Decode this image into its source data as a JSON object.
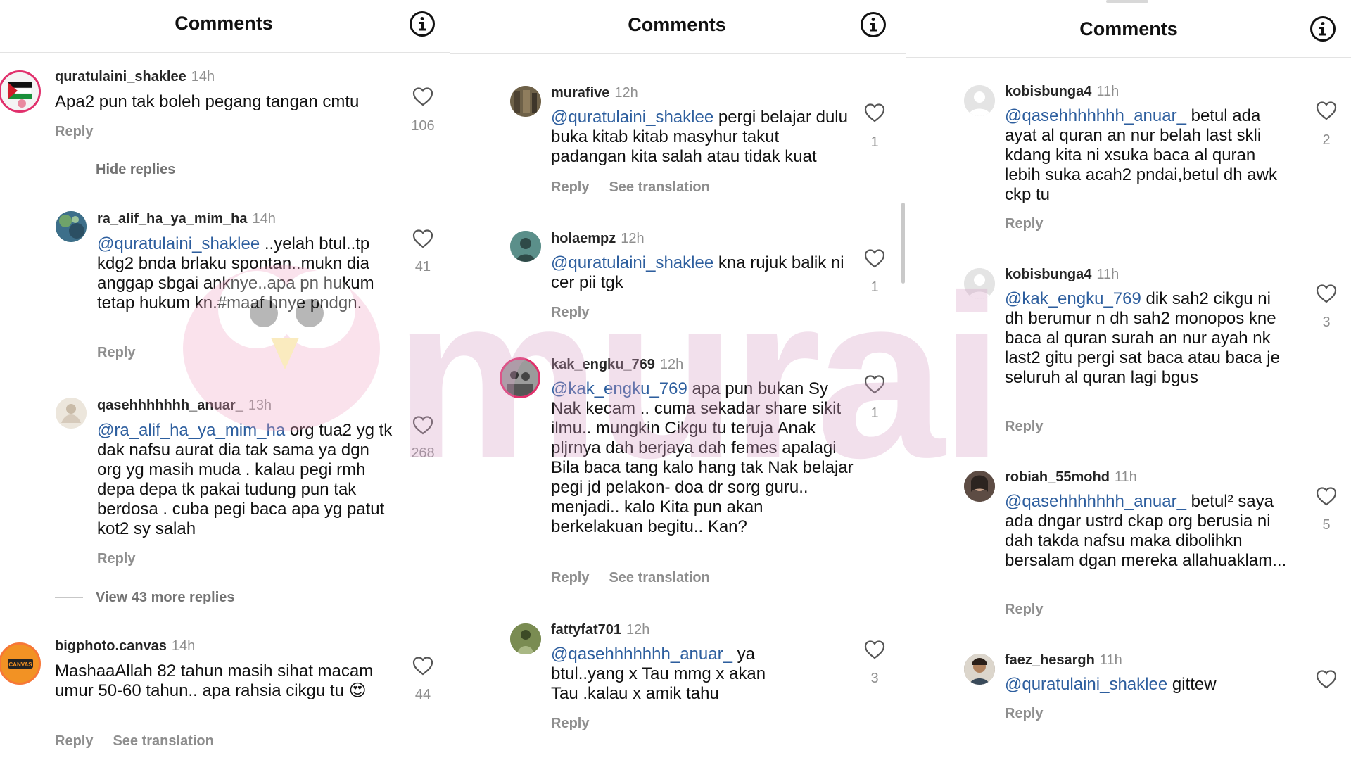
{
  "header": {
    "title": "Comments",
    "info_icon": "info-circle-icon"
  },
  "labels": {
    "reply": "Reply",
    "see_translation": "See translation",
    "hide_replies": "Hide replies",
    "view_more": "View 43 more replies"
  },
  "watermark": "murai",
  "columns": [
    {
      "comments": [
        {
          "user": "quratulaini_shaklee",
          "time": "14h",
          "text": "Apa2 pun tak boleh pegang tangan cmtu",
          "likes": "106"
        },
        {
          "user": "ra_alif_ha_ya_mim_ha",
          "time": "14h",
          "mention": "@quratulaini_shaklee",
          "text": " ..yelah btul..tp kdg2 bnda brlaku spontan..mukn dia anggap sbgai anknye..apa pn hukum tetap hukum kn.#maaf hnye pndgn.",
          "likes": "41"
        },
        {
          "user": "qasehhhhhhh_anuar_",
          "time": "13h",
          "mention": "@ra_alif_ha_ya_mim_ha",
          "text": " org tua2 yg tk dak nafsu aurat dia tak sama ya dgn org yg masih muda . kalau pegi rmh depa depa tk pakai tudung pun tak berdosa . cuba pegi baca apa yg patut kot2 sy salah",
          "likes": "268"
        },
        {
          "user": "bigphoto.canvas",
          "time": "14h",
          "text": "MashaaAllah 82 tahun masih sihat macam umur 50-60 tahun.. apa rahsia cikgu tu 😍",
          "likes": "44",
          "avatar_label": "CANVAS"
        }
      ]
    },
    {
      "comments": [
        {
          "user": "murafive",
          "time": "12h",
          "mention": "@quratulaini_shaklee",
          "text": " pergi belajar dulu buka kitab kitab masyhur takut padangan kita salah atau tidak kuat",
          "likes": "1"
        },
        {
          "user": "holaempz",
          "time": "12h",
          "mention": "@quratulaini_shaklee",
          "text": " kna rujuk balik ni cer pii tgk",
          "likes": "1"
        },
        {
          "user": "kak_engku_769",
          "time": "12h",
          "mention": "@kak_engku_769",
          "text": " apa pun bukan Sy Nak kecam .. cuma sekadar share sikit ilmu.. mungkin Cikgu tu teruja Anak pljrnya dah berjaya dah femes apalagi Bila baca tang kalo hang tak Nak belajar pegi jd pelakon- doa dr sorg guru.. menjadi.. kalo Kita pun akan berkelakuan begitu.. Kan?",
          "likes": "1"
        },
        {
          "user": "fattyfat701",
          "time": "12h",
          "mention": "@qasehhhhhhh_anuar_",
          "text": " ya btul..yang x Tau mmg x akan Tau .kalau x amik tahu",
          "likes": "3"
        }
      ]
    },
    {
      "comments": [
        {
          "user": "kobisbunga4",
          "time": "11h",
          "mention": "@qasehhhhhhh_anuar_",
          "text": " betul ada ayat al quran an nur belah last skli kdang kita ni xsuka baca al quran lebih suka acah2 pndai,betul dh awk ckp tu",
          "likes": "2"
        },
        {
          "user": "kobisbunga4",
          "time": "11h",
          "mention": "@kak_engku_769",
          "text": " dik sah2 cikgu ni dh berumur n dh sah2 monopos kne baca al quran surah an nur ayah nk last2 gitu pergi sat baca atau baca je seluruh al quran lagi bgus",
          "likes": "3"
        },
        {
          "user": "robiah_55mohd",
          "time": "11h",
          "mention": "@qasehhhhhhh_anuar_",
          "text": " betul² saya ada dngar ustrd ckap org berusia ni dah takda nafsu maka dibolihkn bersalam dgan mereka allahuaklam...",
          "likes": "5"
        },
        {
          "user": "faez_hesargh",
          "time": "11h",
          "mention": "@quratulaini_shaklee",
          "text": " gittew",
          "likes": ""
        }
      ]
    }
  ],
  "colors": {
    "mention": "#2d5e9e",
    "muted": "#8e8e8e",
    "story_ring": "#e1306c"
  }
}
